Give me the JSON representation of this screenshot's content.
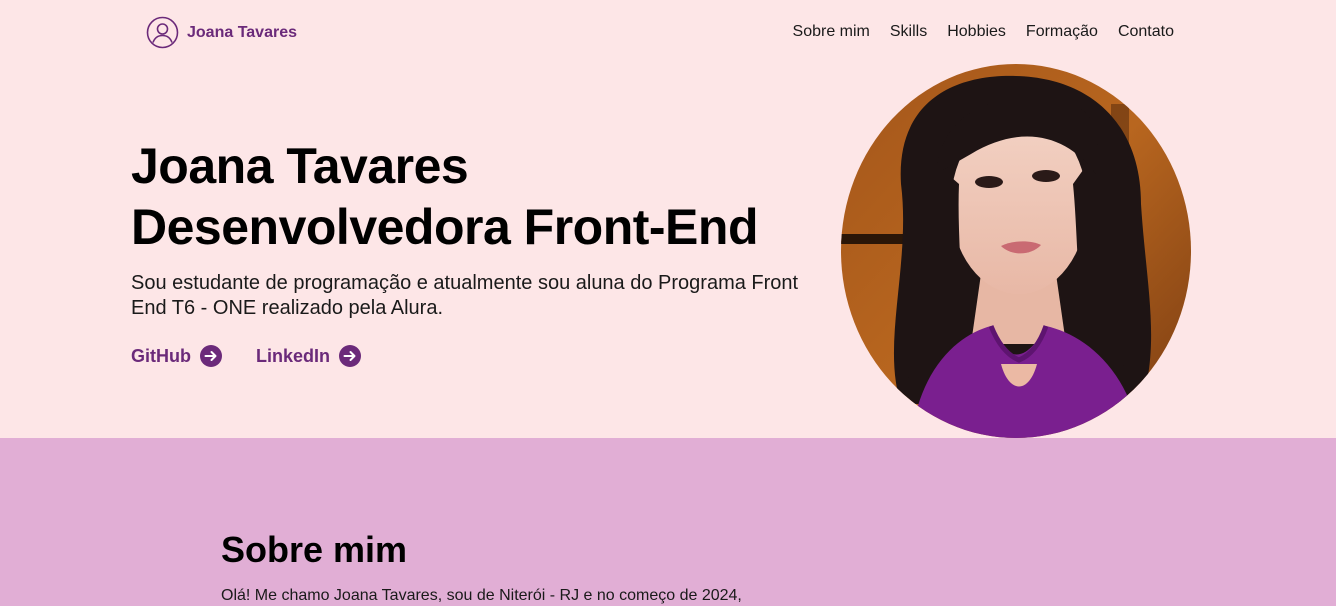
{
  "header": {
    "brand_name": "Joana Tavares",
    "brand_icon": "user-circle-icon",
    "nav": [
      {
        "label": "Sobre mim"
      },
      {
        "label": "Skills"
      },
      {
        "label": "Hobbies"
      },
      {
        "label": "Formação"
      },
      {
        "label": "Contato"
      }
    ]
  },
  "hero": {
    "title_line1": "Joana Tavares",
    "title_line2": "Desenvolvedora Front-End",
    "description": "Sou estudante de programação e atualmente sou aluna do Programa Front End T6 - ONE realizado pela Alura.",
    "links": [
      {
        "label": "GitHub",
        "icon": "arrow-right-circle-icon"
      },
      {
        "label": "LinkedIn",
        "icon": "arrow-right-circle-icon"
      }
    ]
  },
  "about": {
    "title": "Sobre mim",
    "text": "Olá! Me chamo Joana Tavares, sou de Niterói - RJ e no começo de 2024,"
  },
  "colors": {
    "hero_bg": "#fde6e7",
    "about_bg": "#e1aed5",
    "accent": "#6b2a7a"
  }
}
